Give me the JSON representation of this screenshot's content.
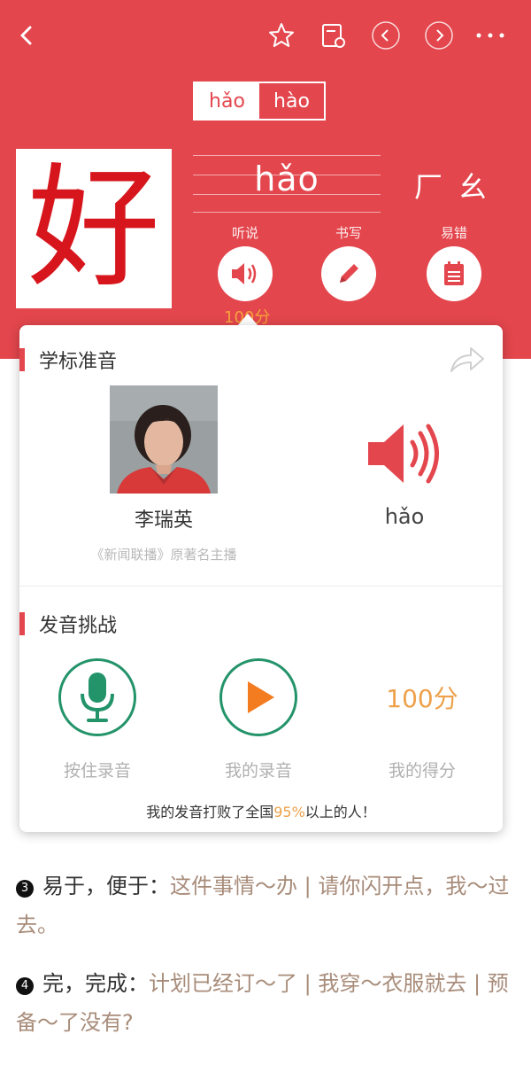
{
  "colors": {
    "primary": "#e3464d",
    "accent_orange": "#eda14b",
    "green": "#23936a"
  },
  "topbar": {
    "back_icon": "back-arrow-icon",
    "star_icon": "star-icon",
    "note_icon": "notebook-icon",
    "prev_icon": "circle-left-icon",
    "next_icon": "circle-right-icon",
    "more_icon": "more-dots-icon"
  },
  "pinyin_tabs": [
    "hǎo",
    "hào"
  ],
  "character": "好",
  "pinyin": "hǎo",
  "radical": "厂 幺",
  "actions": [
    {
      "label": "听说",
      "icon": "speaker-icon"
    },
    {
      "label": "书写",
      "icon": "pencil-icon"
    },
    {
      "label": "易错",
      "icon": "notepad-icon"
    }
  ],
  "listen_score": "100分",
  "standard": {
    "title": "学标准音",
    "speaker_name": "李瑞英",
    "speaker_desc": "《新闻联播》原著名主播",
    "pinyin": "hǎo"
  },
  "challenge": {
    "title": "发音挑战",
    "record_label": "按住录音",
    "my_record_label": "我的录音",
    "score": "100分",
    "score_label": "我的得分",
    "note_before": "我的发音打败了全国",
    "note_percent": "95%",
    "note_after": "以上的人！"
  },
  "definitions": [
    {
      "num": "3",
      "meaning": "易于，便于：",
      "example": "这件事情～办 | 请你闪开点，我～过去。"
    },
    {
      "num": "4",
      "meaning": "完，完成：",
      "example": "计划已经订～了 | 我穿～衣服就去 | 预备～了没有?"
    }
  ]
}
